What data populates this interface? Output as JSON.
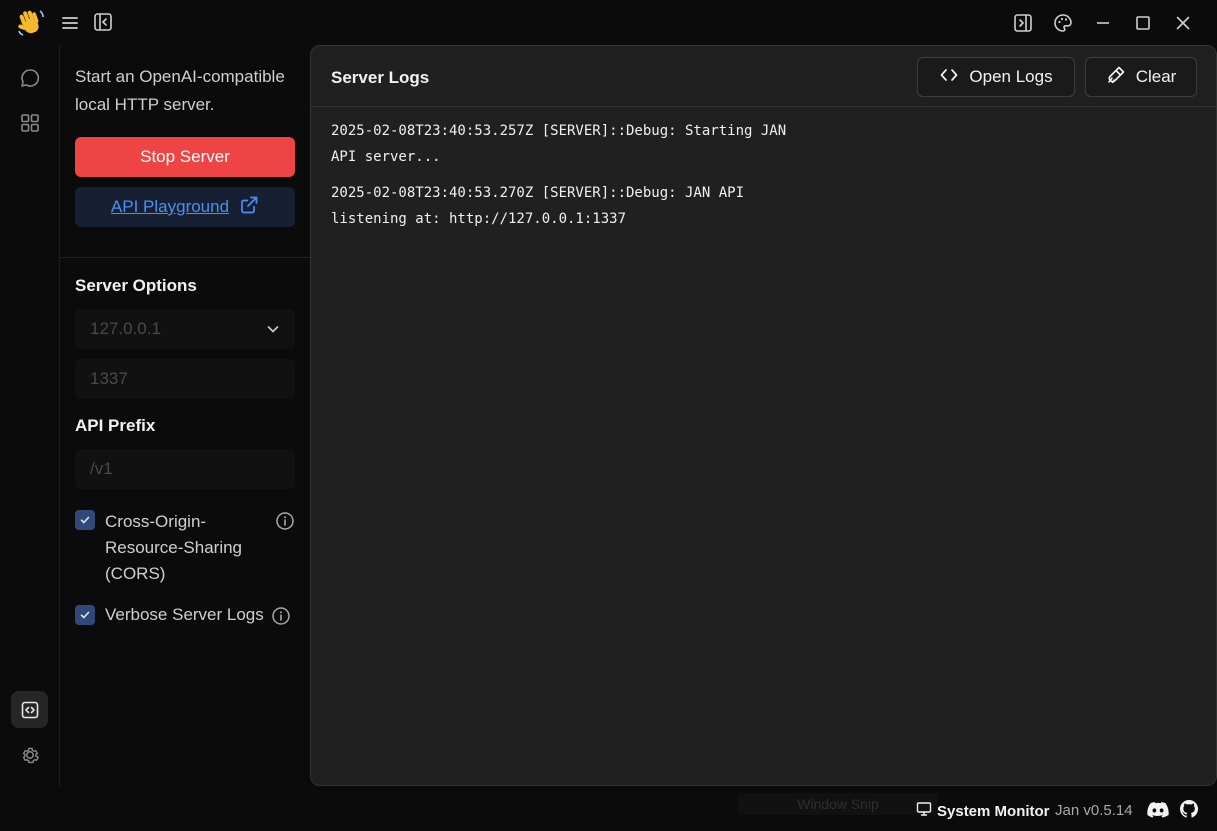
{
  "app": {
    "logo_icon": "waving-hand-icon"
  },
  "left_panel": {
    "description": "Start an OpenAI-compatible local HTTP server.",
    "stop_button": "Stop Server",
    "playground_button": "API Playground",
    "server_options_heading": "Server Options",
    "host_value": "127.0.0.1",
    "port_value": "1337",
    "api_prefix_heading": "API Prefix",
    "api_prefix_value": "/v1",
    "cors": {
      "label": "Cross-Origin-Resource-Sharing (CORS)",
      "checked": true
    },
    "verbose": {
      "label": "Verbose Server Logs",
      "checked": true
    }
  },
  "logs": {
    "title": "Server Logs",
    "open_logs_button": "Open Logs",
    "clear_button": "Clear",
    "entries": [
      "2025-02-08T23:40:53.257Z [SERVER]::Debug: Starting JAN API server...",
      "2025-02-08T23:40:53.270Z [SERVER]::Debug: JAN API listening at: http://127.0.0.1:1337"
    ]
  },
  "status_bar": {
    "ghost_text": "Window Snip",
    "system_monitor": "System Monitor",
    "version": "Jan v0.5.14"
  },
  "colors": {
    "accent_danger": "#ef4444",
    "link": "#4b8ef5",
    "checkbox": "#31497a"
  }
}
